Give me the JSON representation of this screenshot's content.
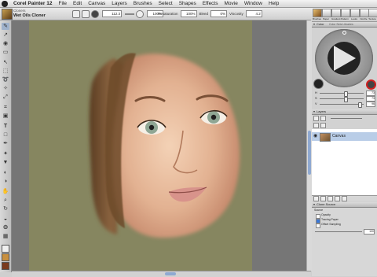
{
  "menubar": {
    "app": "Corel Painter 12",
    "items": [
      "File",
      "Edit",
      "Canvas",
      "Layers",
      "Brushes",
      "Select",
      "Shapes",
      "Effects",
      "Movie",
      "Window",
      "Help"
    ]
  },
  "property_bar": {
    "brush_category": "Cloners",
    "brush_variant": "Wet Oils Cloner",
    "size": "112.3",
    "opacity": "100%",
    "resaturation_label": "Resaturation",
    "resaturation": "100%",
    "bleed_label": "Bleed",
    "bleed": "0%",
    "viscosity_label": "Viscosity",
    "viscosity": "4.2"
  },
  "brush_selector": {
    "items": [
      "Brushes",
      "Paper",
      "Gradient",
      "Pattern",
      "Looks",
      "Nozzle",
      "Texture"
    ]
  },
  "colors": {
    "canvas_bg": "#868660",
    "workspace_bg": "#767676",
    "selection_blue": "#b9cde7",
    "clone_color_ring": "#d02020",
    "main_color": "#232323"
  },
  "color_panel": {
    "tab": "Color",
    "tab2": "Color Sets Libraries",
    "sliders": [
      {
        "label": "H",
        "value": "73"
      },
      {
        "label": "S",
        "value": "73"
      },
      {
        "label": "V",
        "value": "96"
      }
    ]
  },
  "layers_panel": {
    "tab": "Layers",
    "layer": {
      "name": "Canvas"
    }
  },
  "clone_source_panel": {
    "tab": "Clone Source",
    "source_label": "Source",
    "options": [
      {
        "label": "Opacity",
        "checked": false
      },
      {
        "label": "Tracing Paper",
        "checked": true
      },
      {
        "label": "Offset Sampling",
        "checked": false
      }
    ],
    "value": "100"
  },
  "toolbox": {
    "icons": [
      "brush-tool",
      "dropper-tool",
      "paint-bucket-tool",
      "eraser-tool",
      "layer-adjuster-tool",
      "rectangular-selection-tool",
      "lasso-tool",
      "magic-wand-tool",
      "transform-tool",
      "crop-tool",
      "divine-proportion-tool",
      "text-tool",
      "shape-tool",
      "pen-tool",
      "cloner-tool",
      "rubber-stamp-tool",
      "dodge-tool",
      "burn-tool",
      "grabber-tool",
      "magnifier-tool",
      "rotate-page-tool",
      "mirror-tool",
      "kaleidoscope-tool",
      "perspective-grid-tool"
    ]
  }
}
